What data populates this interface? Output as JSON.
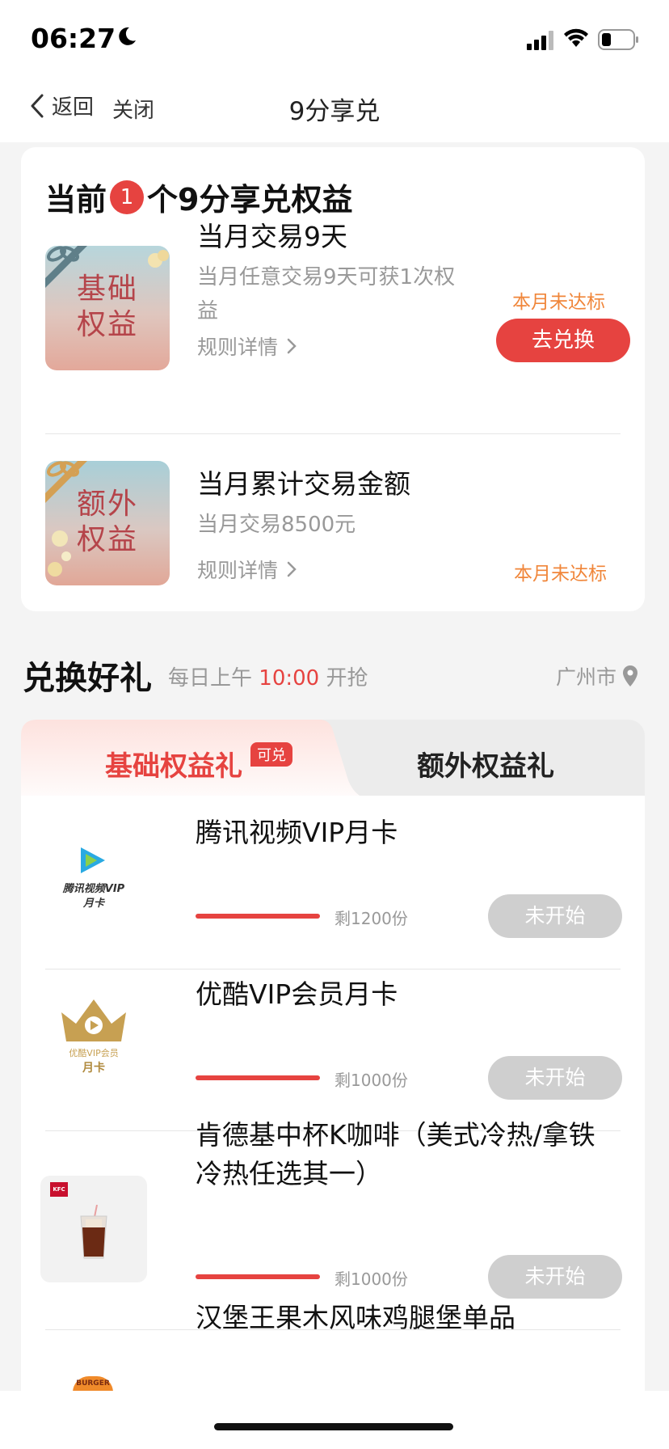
{
  "status_bar": {
    "time": "06:27"
  },
  "nav": {
    "back_label": "返回",
    "close_label": "关闭",
    "title": "9分享兑"
  },
  "benefits": {
    "heading_prefix": "当前",
    "count": "1",
    "heading_suffix": "个9分享兑权益",
    "items": [
      {
        "thumb_line1": "基础",
        "thumb_line2": "权益",
        "title": "当月交易9天",
        "desc_line1": "当月任意交易9天可获1次权",
        "desc_line2": "益",
        "rules": "规则详情",
        "status": "本月未达标",
        "button": "去兑换"
      },
      {
        "thumb_line1": "额外",
        "thumb_line2": "权益",
        "title": "当月累计交易金额",
        "desc_line1": "当月交易8500元",
        "rules": "规则详情",
        "status": "本月未达标"
      }
    ]
  },
  "gifts": {
    "title": "兑换好礼",
    "sub_prefix": "每日上午",
    "sub_time": "10:00",
    "sub_suffix": "开抢",
    "city": "广州市",
    "tabs": [
      {
        "label": "基础权益礼",
        "badge": "可兑"
      },
      {
        "label": "额外权益礼"
      }
    ],
    "items": [
      {
        "logo_text1": "腾讯视频VIP",
        "logo_text2": "月卡",
        "title": "腾讯视频VIP月卡",
        "remain": "剩1200份",
        "button": "未开始",
        "progress": 1.0
      },
      {
        "logo_text1": "优酷VIP会员",
        "logo_text2": "月卡",
        "title": "优酷VIP会员月卡",
        "remain": "剩1000份",
        "button": "未开始",
        "progress": 1.0
      },
      {
        "logo_text1": "KFC",
        "title_line1": "肯德基中杯K咖啡（美式冷热/拿铁",
        "title_line2": "冷热任选其一）",
        "remain": "剩1000份",
        "button": "未开始",
        "progress": 1.0
      },
      {
        "logo_text1": "BURGER",
        "title": "汉堡王果木风味鸡腿堡单品"
      }
    ]
  },
  "colors": {
    "accent": "#e64340",
    "warning": "#f0863a",
    "disabled": "#cfcfcf"
  }
}
